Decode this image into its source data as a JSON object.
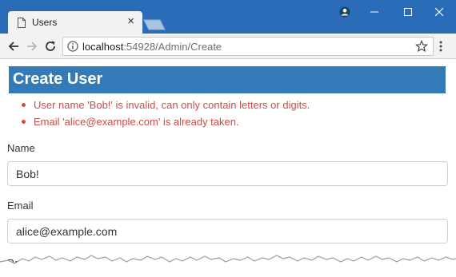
{
  "browser": {
    "tab_title": "Users",
    "tab_close": "×",
    "url_host": "localhost",
    "url_path": ":54928/Admin/Create"
  },
  "page": {
    "title": "Create User",
    "errors": [
      "User name 'Bob!' is invalid, can only contain letters or digits.",
      "Email 'alice@example.com' is already taken."
    ],
    "form": {
      "name_label": "Name",
      "name_value": "Bob!",
      "email_label": "Email",
      "email_value": "alice@example.com",
      "password_label_partial": "Pa"
    }
  },
  "colors": {
    "titlebar": "#2b6cb8",
    "header": "#337ab7",
    "error": "#d04a46"
  },
  "icons": [
    "page-icon",
    "close-icon",
    "new-tab-icon",
    "profile-icon",
    "minimize-icon",
    "maximize-icon",
    "close-window-icon",
    "back-icon",
    "forward-icon",
    "reload-icon",
    "info-icon",
    "star-icon",
    "menu-icon"
  ]
}
